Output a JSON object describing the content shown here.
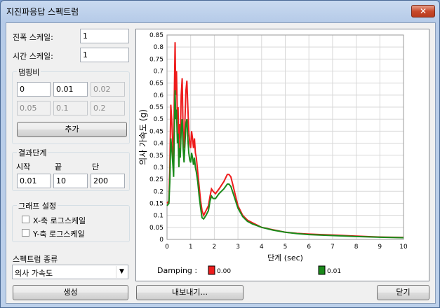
{
  "window": {
    "title": "지진파응답 스펙트럼",
    "close_symbol": "✕"
  },
  "scale": {
    "amplitude_label": "진폭 스케일:",
    "amplitude_value": "1",
    "time_label": "시간 스케일:",
    "time_value": "1"
  },
  "damping": {
    "group_label": "댐핑비",
    "values": [
      "0",
      "0.01",
      "0.02",
      "0.05",
      "0.1",
      "0.2"
    ],
    "add_label": "추가"
  },
  "result_step": {
    "group_label": "결과단계",
    "start_label": "시작",
    "end_label": "끝",
    "step_label": "단",
    "start_value": "0.01",
    "end_value": "10",
    "step_value": "200"
  },
  "graph_settings": {
    "group_label": "그래프 설정",
    "x_log_label": "X-축 로그스케일",
    "y_log_label": "Y-축 로그스케일",
    "x_log_checked": false,
    "y_log_checked": false
  },
  "spectrum_type": {
    "label": "스펙트럼 종류",
    "selected": "의사 가속도"
  },
  "buttons": {
    "generate": "생성",
    "export": "내보내기...",
    "close": "닫기"
  },
  "chart_data": {
    "type": "line",
    "ylabel": "의사 가속도 (g)",
    "xlabel": "단계 (sec)",
    "xlim": [
      0,
      10
    ],
    "ylim": [
      0,
      0.85
    ],
    "x_ticks": [
      "0",
      "1",
      "2",
      "3",
      "4",
      "5",
      "6",
      "7",
      "8",
      "9",
      "10"
    ],
    "y_ticks": [
      "0",
      "0.05",
      "0.1",
      "0.15",
      "0.2",
      "0.25",
      "0.3",
      "0.35",
      "0.4",
      "0.45",
      "0.5",
      "0.55",
      "0.6",
      "0.65",
      "0.7",
      "0.75",
      "0.8",
      "0.85"
    ],
    "grid": true,
    "legend_title": "Damping :",
    "series": [
      {
        "name": "0.00",
        "color": "#ee1c1c",
        "points": [
          [
            0,
            0.15
          ],
          [
            0.08,
            0.16
          ],
          [
            0.12,
            0.3
          ],
          [
            0.16,
            0.56
          ],
          [
            0.2,
            0.5
          ],
          [
            0.24,
            0.4
          ],
          [
            0.28,
            0.3
          ],
          [
            0.31,
            0.6
          ],
          [
            0.34,
            0.82
          ],
          [
            0.37,
            0.6
          ],
          [
            0.4,
            0.7
          ],
          [
            0.44,
            0.5
          ],
          [
            0.47,
            0.55
          ],
          [
            0.5,
            0.35
          ],
          [
            0.53,
            0.48
          ],
          [
            0.56,
            0.42
          ],
          [
            0.6,
            0.6
          ],
          [
            0.64,
            0.67
          ],
          [
            0.68,
            0.45
          ],
          [
            0.72,
            0.38
          ],
          [
            0.76,
            0.5
          ],
          [
            0.8,
            0.62
          ],
          [
            0.84,
            0.66
          ],
          [
            0.88,
            0.55
          ],
          [
            0.92,
            0.45
          ],
          [
            0.96,
            0.4
          ],
          [
            1.0,
            0.38
          ],
          [
            1.04,
            0.45
          ],
          [
            1.08,
            0.42
          ],
          [
            1.12,
            0.38
          ],
          [
            1.16,
            0.42
          ],
          [
            1.2,
            0.36
          ],
          [
            1.24,
            0.34
          ],
          [
            1.3,
            0.28
          ],
          [
            1.36,
            0.22
          ],
          [
            1.42,
            0.16
          ],
          [
            1.48,
            0.12
          ],
          [
            1.55,
            0.1
          ],
          [
            1.65,
            0.12
          ],
          [
            1.75,
            0.14
          ],
          [
            1.82,
            0.18
          ],
          [
            1.88,
            0.21
          ],
          [
            1.95,
            0.2
          ],
          [
            2.05,
            0.19
          ],
          [
            2.2,
            0.21
          ],
          [
            2.4,
            0.24
          ],
          [
            2.55,
            0.27
          ],
          [
            2.62,
            0.27
          ],
          [
            2.7,
            0.26
          ],
          [
            2.8,
            0.22
          ],
          [
            2.9,
            0.18
          ],
          [
            3.0,
            0.14
          ],
          [
            3.2,
            0.1
          ],
          [
            3.4,
            0.08
          ],
          [
            3.6,
            0.07
          ],
          [
            4.0,
            0.05
          ],
          [
            4.5,
            0.04
          ],
          [
            5.0,
            0.03
          ],
          [
            5.5,
            0.025
          ],
          [
            6.0,
            0.022
          ],
          [
            7.0,
            0.018
          ],
          [
            8.0,
            0.014
          ],
          [
            9.0,
            0.01
          ],
          [
            10.0,
            0.008
          ]
        ]
      },
      {
        "name": "0.01",
        "color": "#1a8a1a",
        "points": [
          [
            0,
            0.14
          ],
          [
            0.08,
            0.15
          ],
          [
            0.12,
            0.24
          ],
          [
            0.16,
            0.42
          ],
          [
            0.2,
            0.38
          ],
          [
            0.24,
            0.32
          ],
          [
            0.28,
            0.26
          ],
          [
            0.31,
            0.44
          ],
          [
            0.34,
            0.62
          ],
          [
            0.37,
            0.5
          ],
          [
            0.4,
            0.54
          ],
          [
            0.44,
            0.4
          ],
          [
            0.47,
            0.44
          ],
          [
            0.5,
            0.3
          ],
          [
            0.53,
            0.38
          ],
          [
            0.56,
            0.34
          ],
          [
            0.6,
            0.46
          ],
          [
            0.64,
            0.5
          ],
          [
            0.68,
            0.38
          ],
          [
            0.72,
            0.32
          ],
          [
            0.76,
            0.4
          ],
          [
            0.8,
            0.48
          ],
          [
            0.84,
            0.5
          ],
          [
            0.88,
            0.42
          ],
          [
            0.92,
            0.36
          ],
          [
            0.96,
            0.33
          ],
          [
            1.0,
            0.32
          ],
          [
            1.04,
            0.36
          ],
          [
            1.08,
            0.34
          ],
          [
            1.12,
            0.31
          ],
          [
            1.16,
            0.34
          ],
          [
            1.2,
            0.3
          ],
          [
            1.24,
            0.28
          ],
          [
            1.3,
            0.24
          ],
          [
            1.36,
            0.18
          ],
          [
            1.42,
            0.13
          ],
          [
            1.48,
            0.09
          ],
          [
            1.55,
            0.085
          ],
          [
            1.65,
            0.1
          ],
          [
            1.75,
            0.12
          ],
          [
            1.82,
            0.16
          ],
          [
            1.88,
            0.18
          ],
          [
            1.95,
            0.17
          ],
          [
            2.05,
            0.17
          ],
          [
            2.2,
            0.19
          ],
          [
            2.4,
            0.21
          ],
          [
            2.55,
            0.23
          ],
          [
            2.62,
            0.23
          ],
          [
            2.7,
            0.22
          ],
          [
            2.8,
            0.19
          ],
          [
            2.9,
            0.16
          ],
          [
            3.0,
            0.13
          ],
          [
            3.2,
            0.095
          ],
          [
            3.4,
            0.075
          ],
          [
            3.6,
            0.065
          ],
          [
            4.0,
            0.05
          ],
          [
            4.5,
            0.038
          ],
          [
            5.0,
            0.03
          ],
          [
            5.5,
            0.024
          ],
          [
            6.0,
            0.02
          ],
          [
            7.0,
            0.016
          ],
          [
            8.0,
            0.012
          ],
          [
            9.0,
            0.009
          ],
          [
            10.0,
            0.007
          ]
        ]
      }
    ]
  }
}
